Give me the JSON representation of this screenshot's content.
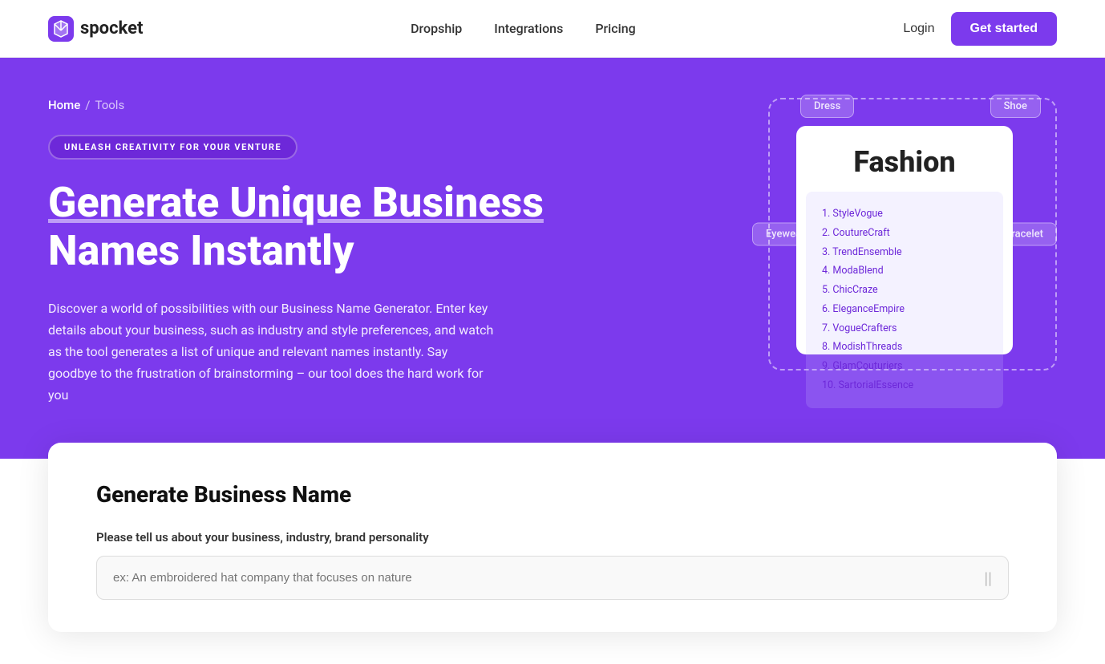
{
  "nav": {
    "logo_text": "spocket",
    "links": [
      {
        "label": "Dropship",
        "id": "dropship"
      },
      {
        "label": "Integrations",
        "id": "integrations"
      },
      {
        "label": "Pricing",
        "id": "pricing"
      }
    ],
    "login_label": "Login",
    "get_started_label": "Get started"
  },
  "hero": {
    "breadcrumb_home": "Home",
    "breadcrumb_sep": "/",
    "breadcrumb_current": "Tools",
    "badge": "UNLEASH CREATIVITY FOR YOUR VENTURE",
    "title_line1": "Generate Unique Business",
    "title_line2": "Names Instantly",
    "description": "Discover a world of possibilities with our Business Name Generator. Enter key details about your business, such as industry and style preferences, and watch as the tool generates a list of unique and relevant names instantly. Say goodbye to the frustration of brainstorming – our tool does the hard work for you",
    "illustration": {
      "center_label": "Fashion",
      "tags": [
        "Dress",
        "Shoe",
        "Eyewear",
        "Bracelet"
      ],
      "names": [
        "1. StyleVogue",
        "2. CoutureCraft",
        "3. TrendEnsemble",
        "4. ModaBlend",
        "5. ChicCraze",
        "6. EleganceEmpire",
        "7. VogueCrafters",
        "8. ModishThreads",
        "9. GlamCouturiers",
        "10. SartorialEssence"
      ]
    }
  },
  "form": {
    "title": "Generate Business Name",
    "label": "Please tell us about your business, industry, brand personality",
    "input_placeholder": "ex: An embroidered hat company that focuses on nature"
  }
}
